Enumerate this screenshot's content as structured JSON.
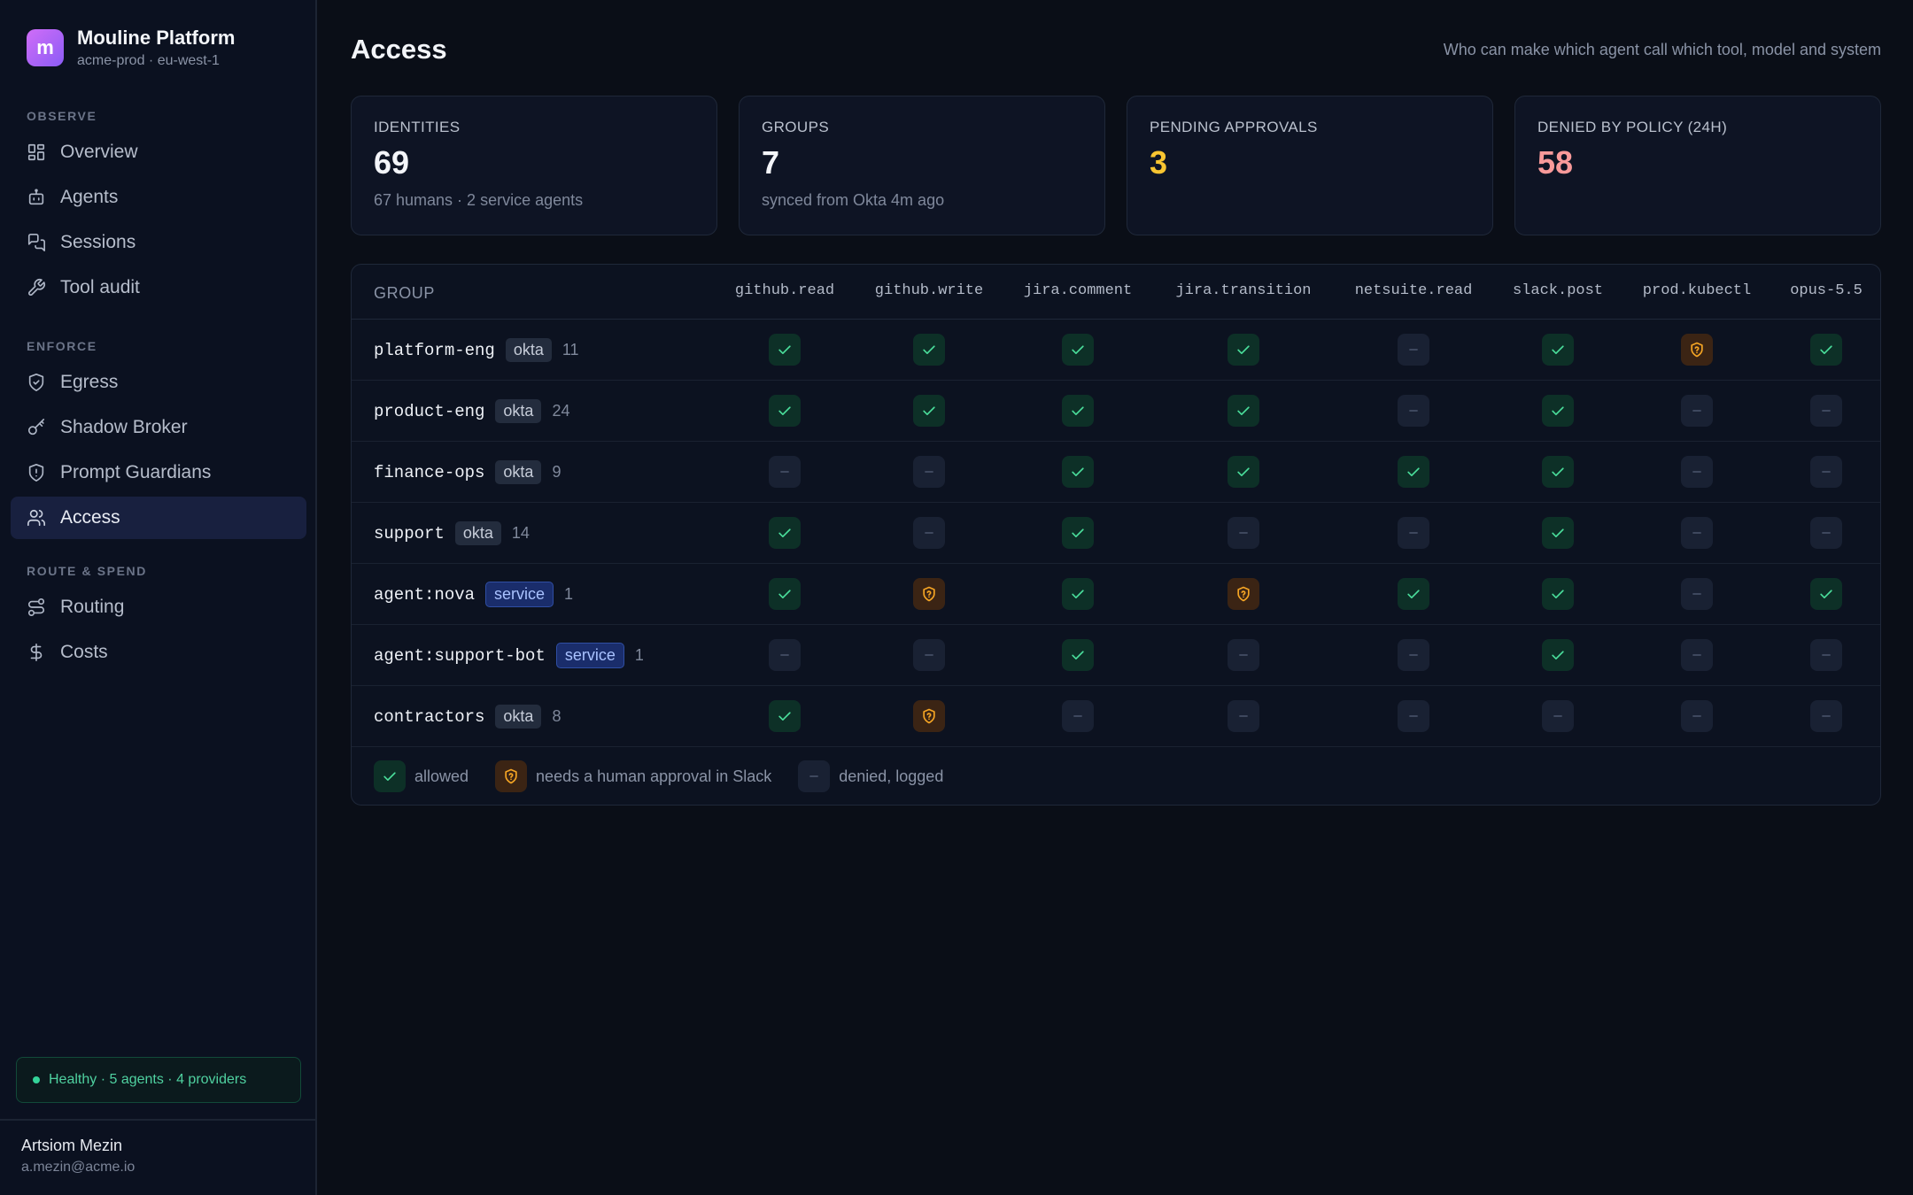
{
  "brand": {
    "logo_letter": "m",
    "title": "Mouline Platform",
    "subtitle": "acme-prod · eu-west-1"
  },
  "nav": {
    "sections": [
      {
        "label": "OBSERVE",
        "items": [
          {
            "label": "Overview",
            "icon": "grid-icon"
          },
          {
            "label": "Agents",
            "icon": "bot-icon"
          },
          {
            "label": "Sessions",
            "icon": "chat-icon"
          },
          {
            "label": "Tool audit",
            "icon": "wrench-icon"
          }
        ]
      },
      {
        "label": "ENFORCE",
        "items": [
          {
            "label": "Egress",
            "icon": "shield-check-icon"
          },
          {
            "label": "Shadow Broker",
            "icon": "key-icon"
          },
          {
            "label": "Prompt Guardians",
            "icon": "shield-alert-icon"
          },
          {
            "label": "Access",
            "icon": "users-icon",
            "active": true
          }
        ]
      },
      {
        "label": "ROUTE & SPEND",
        "items": [
          {
            "label": "Routing",
            "icon": "route-icon"
          },
          {
            "label": "Costs",
            "icon": "dollar-icon"
          }
        ]
      }
    ]
  },
  "health": {
    "text": "Healthy · 5 agents · 4 providers",
    "color": "#34d399"
  },
  "user": {
    "name": "Artsiom Mezin",
    "email": "a.mezin@acme.io"
  },
  "page": {
    "title": "Access",
    "subtitle": "Who can make which agent call which tool, model and system"
  },
  "stats": [
    {
      "label": "IDENTITIES",
      "value": "69",
      "note": "67 humans · 2 service agents",
      "color": "#f3f5f9"
    },
    {
      "label": "GROUPS",
      "value": "7",
      "note": "synced from Okta 4m ago",
      "color": "#f3f5f9"
    },
    {
      "label": "PENDING APPROVALS",
      "value": "3",
      "note": "",
      "color": "#f8c531"
    },
    {
      "label": "DENIED BY POLICY (24H)",
      "value": "58",
      "note": "",
      "color": "#f99a9a"
    }
  ],
  "matrix": {
    "group_header": "GROUP",
    "columns": [
      "github.read",
      "github.write",
      "jira.comment",
      "jira.transition",
      "netsuite.read",
      "slack.post",
      "prod.kubectl",
      "opus-5.5"
    ],
    "rows": [
      {
        "name": "platform-eng",
        "tag": "okta",
        "tag_type": "okta",
        "count": "11",
        "cells": [
          "allowed",
          "allowed",
          "allowed",
          "allowed",
          "denied",
          "allowed",
          "approval",
          "allowed"
        ]
      },
      {
        "name": "product-eng",
        "tag": "okta",
        "tag_type": "okta",
        "count": "24",
        "cells": [
          "allowed",
          "allowed",
          "allowed",
          "allowed",
          "denied",
          "allowed",
          "denied",
          "denied"
        ]
      },
      {
        "name": "finance-ops",
        "tag": "okta",
        "tag_type": "okta",
        "count": "9",
        "cells": [
          "denied",
          "denied",
          "allowed",
          "allowed",
          "allowed",
          "allowed",
          "denied",
          "denied"
        ]
      },
      {
        "name": "support",
        "tag": "okta",
        "tag_type": "okta",
        "count": "14",
        "cells": [
          "allowed",
          "denied",
          "allowed",
          "denied",
          "denied",
          "allowed",
          "denied",
          "denied"
        ]
      },
      {
        "name": "agent:nova",
        "tag": "service",
        "tag_type": "service",
        "count": "1",
        "cells": [
          "allowed",
          "approval",
          "allowed",
          "approval",
          "allowed",
          "allowed",
          "denied",
          "allowed"
        ]
      },
      {
        "name": "agent:support-bot",
        "tag": "service",
        "tag_type": "service",
        "count": "1",
        "cells": [
          "denied",
          "denied",
          "allowed",
          "denied",
          "denied",
          "allowed",
          "denied",
          "denied"
        ]
      },
      {
        "name": "contractors",
        "tag": "okta",
        "tag_type": "okta",
        "count": "8",
        "cells": [
          "allowed",
          "approval",
          "denied",
          "denied",
          "denied",
          "denied",
          "denied",
          "denied"
        ]
      }
    ],
    "legend": [
      {
        "status": "allowed",
        "label": "allowed"
      },
      {
        "status": "approval",
        "label": "needs a human approval in Slack"
      },
      {
        "status": "denied",
        "label": "denied, logged"
      }
    ]
  }
}
